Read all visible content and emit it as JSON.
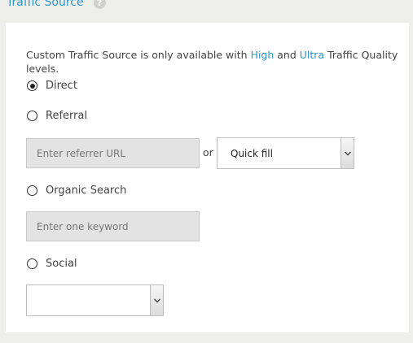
{
  "section": {
    "title": "Traffic Source",
    "help_icon": "?"
  },
  "note": {
    "prefix": "Custom Traffic Source is only available with ",
    "high": "High",
    "and": " and ",
    "ultra": "Ultra",
    "suffix": " Traffic Quality levels."
  },
  "options": {
    "direct": {
      "label": "Direct",
      "checked": true
    },
    "referral": {
      "label": "Referral",
      "checked": false
    },
    "organic": {
      "label": "Organic Search",
      "checked": false
    },
    "social": {
      "label": "Social",
      "checked": false
    }
  },
  "referral": {
    "url_placeholder": "Enter referrer URL",
    "or_label": "or",
    "quick_fill_value": "Quick fill"
  },
  "organic": {
    "keyword_placeholder": "Enter one keyword"
  },
  "social": {
    "select_value": ""
  },
  "colors": {
    "accent": "#2f95c8",
    "background": "#eeeeea",
    "card": "#ffffff",
    "input_disabled": "#e3e3e3"
  }
}
